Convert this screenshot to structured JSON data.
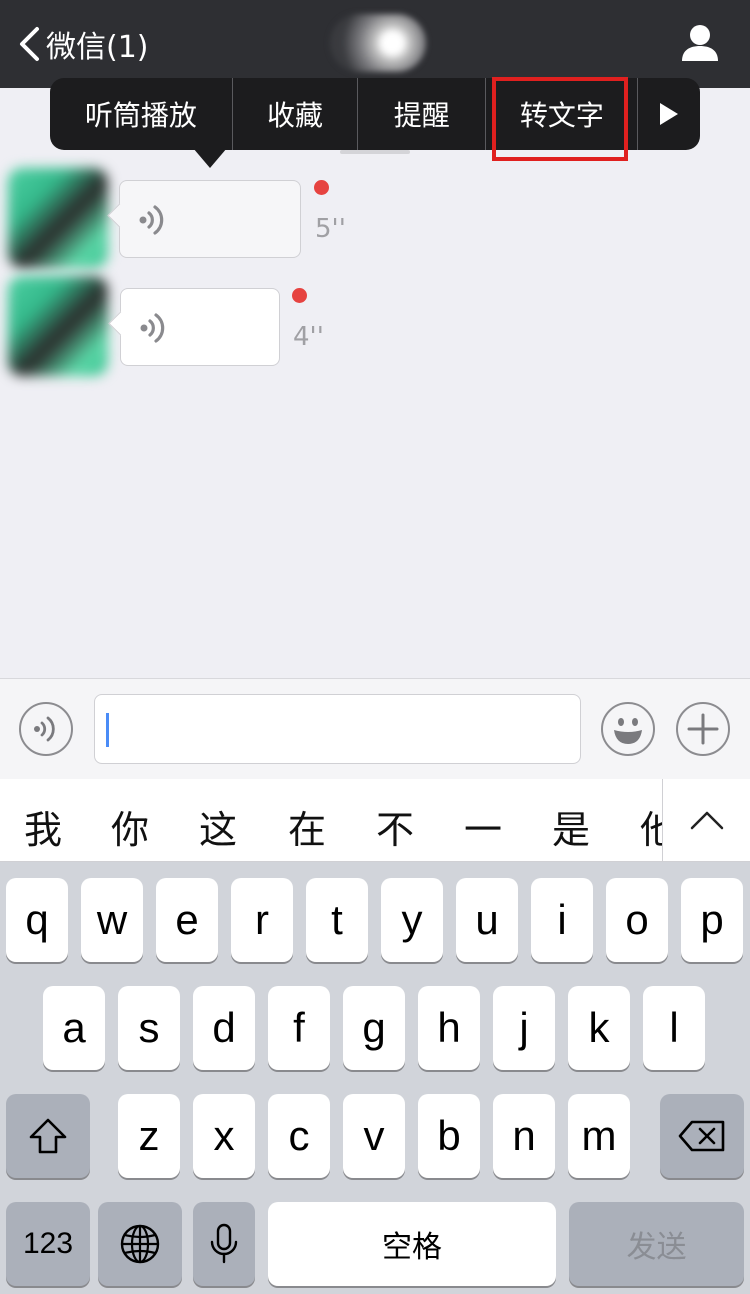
{
  "navbar": {
    "back_label": "微信(1)"
  },
  "context_menu": {
    "items": [
      "听筒播放",
      "收藏",
      "提醒",
      "转文字"
    ],
    "highlighted_index": 3,
    "highlight_color": "#e0201f"
  },
  "messages": [
    {
      "duration": "5''",
      "unread": true
    },
    {
      "duration": "4''",
      "unread": true
    }
  ],
  "input_bar": {
    "text": ""
  },
  "candidates": {
    "items": [
      "我",
      "你",
      "这",
      "在",
      "不",
      "一",
      "是",
      "他"
    ]
  },
  "keyboard": {
    "row1": [
      "q",
      "w",
      "e",
      "r",
      "t",
      "y",
      "u",
      "i",
      "o",
      "p"
    ],
    "row2": [
      "a",
      "s",
      "d",
      "f",
      "g",
      "h",
      "j",
      "k",
      "l"
    ],
    "row3": [
      "z",
      "x",
      "c",
      "v",
      "b",
      "n",
      "m"
    ],
    "numbers_label": "123",
    "space_label": "空格",
    "send_label": "发送"
  },
  "colors": {
    "navbar_bg": "#2e2f33",
    "unread_dot": "#e64340",
    "caret": "#4a8cf7"
  }
}
